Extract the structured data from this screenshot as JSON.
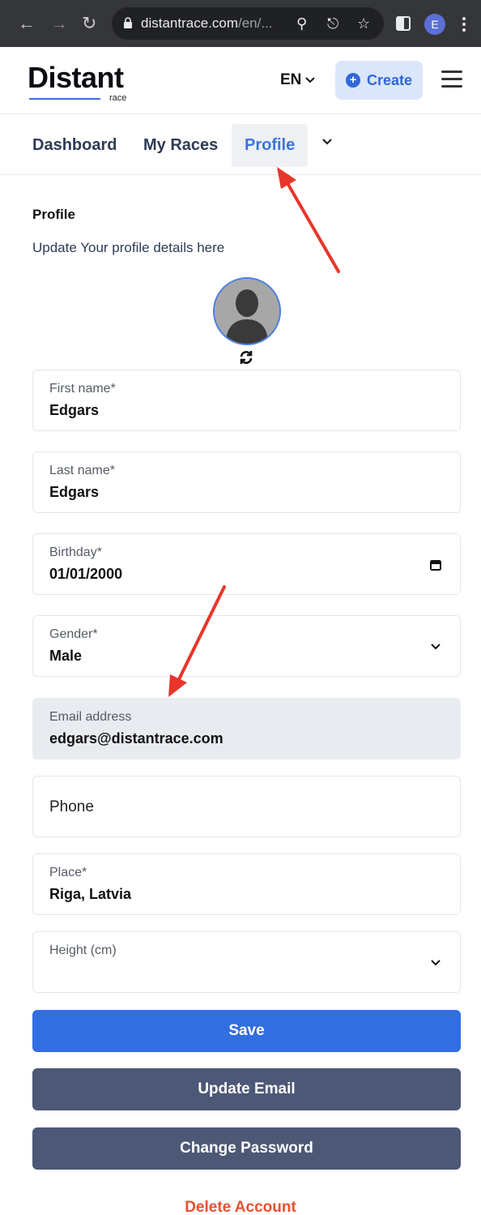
{
  "browser": {
    "url_host": "distantrace.com",
    "url_rest": "/en/...",
    "profile_initial": "E"
  },
  "header": {
    "logo_text": "Distant",
    "logo_sub": "race",
    "language": "EN",
    "create_label": "Create"
  },
  "tabs": [
    {
      "label": "Dashboard"
    },
    {
      "label": "My Races"
    },
    {
      "label": "Profile"
    }
  ],
  "profile": {
    "title": "Profile",
    "subtitle": "Update Your profile details here"
  },
  "fields": {
    "first_name": {
      "label": "First name*",
      "value": "Edgars"
    },
    "last_name": {
      "label": "Last name*",
      "value": "Edgars"
    },
    "birthday": {
      "label": "Birthday*",
      "value": "01/01/2000"
    },
    "gender": {
      "label": "Gender*",
      "value": "Male"
    },
    "email": {
      "label": "Email address",
      "value": "edgars@distantrace.com"
    },
    "phone": {
      "placeholder": "Phone"
    },
    "place": {
      "label": "Place*",
      "value": "Riga, Latvia"
    },
    "height": {
      "label": "Height (cm)"
    }
  },
  "actions": {
    "save": "Save",
    "update_email": "Update Email",
    "change_password": "Change Password",
    "delete_account": "Delete Account"
  },
  "colors": {
    "accent": "#316ee2",
    "secondary_button": "#4d5876",
    "danger": "#e8502f",
    "annotation_arrow": "#e8362a"
  }
}
